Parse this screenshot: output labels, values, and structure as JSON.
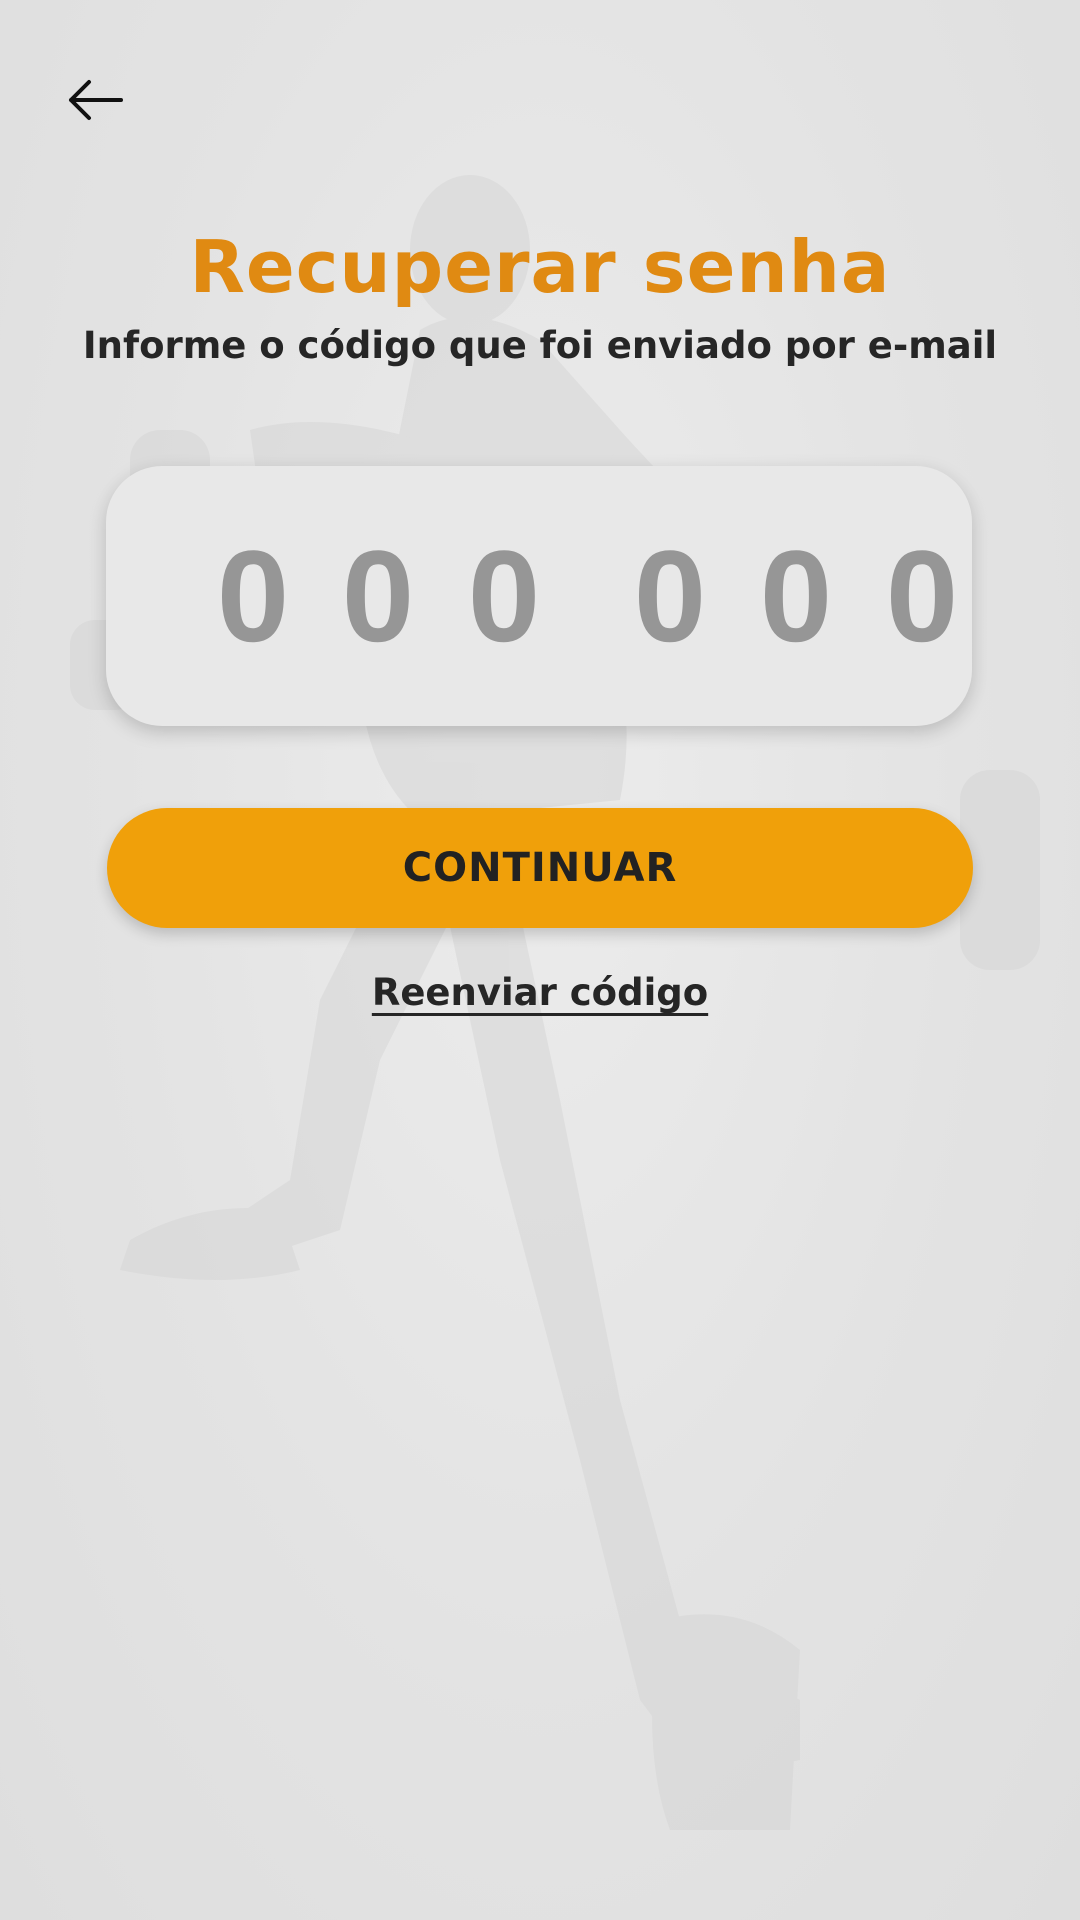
{
  "header": {
    "back_icon": "arrow-left-icon"
  },
  "page": {
    "title": "Recuperar senha",
    "subtitle": "Informe o código que foi enviado por e-mail"
  },
  "code_input": {
    "digits": [
      "0",
      "0",
      "0",
      "0",
      "0",
      "0"
    ]
  },
  "actions": {
    "continue_label": "CONTINUAR",
    "resend_label": "Reenviar código"
  },
  "colors": {
    "accent": "#E08A12",
    "button": "#F0A00A",
    "digit": "#969696",
    "text": "#262626"
  }
}
